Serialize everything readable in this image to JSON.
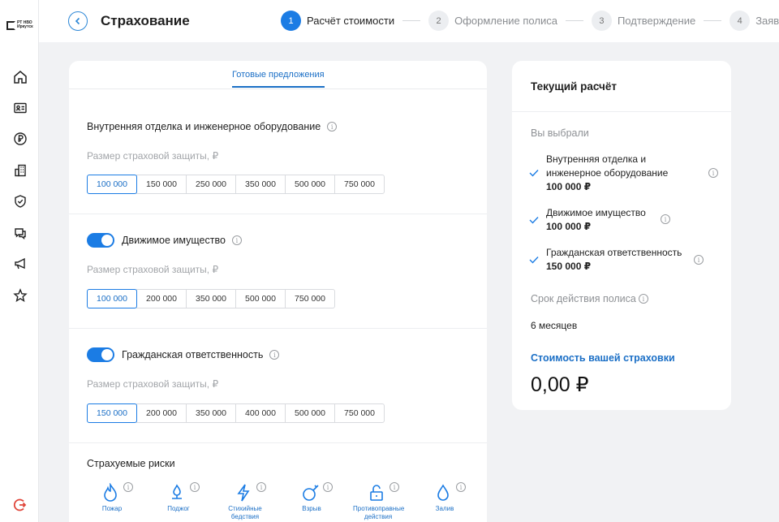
{
  "logo": {
    "line1": "РТ НВО",
    "line2": "Иркутск"
  },
  "sidebar": {
    "items": [
      {
        "icon": "home-icon"
      },
      {
        "icon": "id-card-icon"
      },
      {
        "icon": "ruble-icon"
      },
      {
        "icon": "building-icon"
      },
      {
        "icon": "shield-check-icon"
      },
      {
        "icon": "chat-icon"
      },
      {
        "icon": "megaphone-icon"
      },
      {
        "icon": "star-icon"
      }
    ],
    "bottom_icon": "logout-icon"
  },
  "header": {
    "title": "Страхование"
  },
  "steps": [
    {
      "num": "1",
      "label": "Расчёт стоимости",
      "active": true
    },
    {
      "num": "2",
      "label": "Оформление полиса"
    },
    {
      "num": "3",
      "label": "Подтверждение"
    },
    {
      "num": "4",
      "label": "Заявка"
    }
  ],
  "form": {
    "tab": "Готовые предложения",
    "sections": [
      {
        "title": "Внутренняя отделка и инженерное оборудование",
        "sublabel": "Размер страховой защиты, ₽",
        "options": [
          "100 000",
          "150 000",
          "250 000",
          "350 000",
          "500 000",
          "750 000"
        ],
        "selected": "100 000"
      },
      {
        "title": "Движимое имущество",
        "toggle": true,
        "sublabel": "Размер страховой защиты, ₽",
        "options": [
          "100 000",
          "200 000",
          "350 000",
          "500 000",
          "750 000"
        ],
        "selected": "100 000"
      },
      {
        "title": "Гражданская ответственность",
        "toggle": true,
        "sublabel": "Размер страховой защиты, ₽",
        "options": [
          "150 000",
          "200 000",
          "350 000",
          "400 000",
          "500 000",
          "750 000"
        ],
        "selected": "150 000"
      }
    ],
    "risks_title": "Страхуемые риски",
    "risks": [
      {
        "label": "Пожар",
        "icon": "fire-icon"
      },
      {
        "label": "Поджог",
        "icon": "arson-icon"
      },
      {
        "label": "Стихийные бедствия",
        "icon": "lightning-icon"
      },
      {
        "label": "Взрыв",
        "icon": "explosion-icon"
      },
      {
        "label": "Противоправные действия",
        "icon": "lock-icon"
      },
      {
        "label": "Залив",
        "icon": "water-drop-icon"
      }
    ]
  },
  "summary": {
    "title": "Текущий расчёт",
    "chosen_label": "Вы выбрали",
    "items": [
      {
        "name": "Внутренняя отделка и инженерное оборудование",
        "amount": "100 000 ₽"
      },
      {
        "name": "Движимое имущество",
        "amount": "100 000 ₽"
      },
      {
        "name": "Гражданская ответственность",
        "amount": "150 000 ₽"
      }
    ],
    "term_label": "Срок действия полиса",
    "term_value": "6 месяцев",
    "cost_label": "Стоимость вашей страховки",
    "cost_value": "0,00 ₽"
  },
  "colors": {
    "accent": "#1b7ce4",
    "link": "#1b6fc6",
    "background": "#f1f2f4"
  }
}
